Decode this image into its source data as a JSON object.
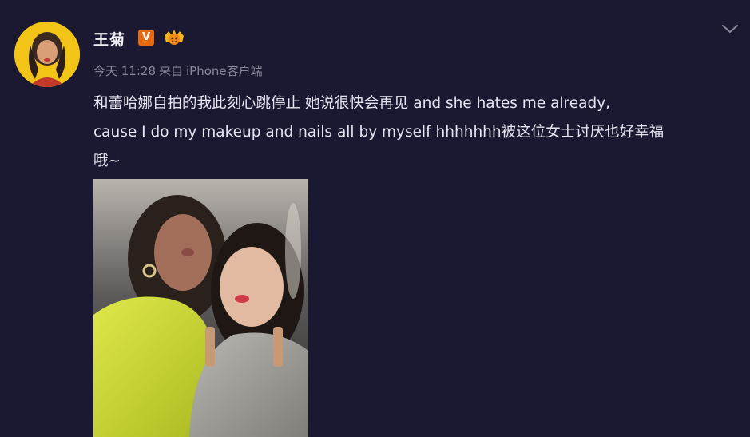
{
  "post": {
    "username": "王菊",
    "verified_badge": "V",
    "timestamp": "今天 11:28",
    "source_prefix": "来自",
    "source_device": "iPhone客户端",
    "text_lines": [
      "和蕾哈娜自拍的我此刻心跳停止 她说很快会再见 and she hates me already,",
      "cause I do my makeup and nails all by myself hhhhhhh被这位女士讨厌也好幸福",
      "哦~"
    ]
  },
  "icons": {
    "avatar": "avatar-icon",
    "verified": "verified-v-icon",
    "crown": "crown-badge-icon",
    "more": "chevron-down-icon"
  },
  "colors": {
    "background": "#1b1832",
    "verified_badge": "#e86a10",
    "text": "#e6e4ef",
    "meta_text": "#8a879a"
  }
}
